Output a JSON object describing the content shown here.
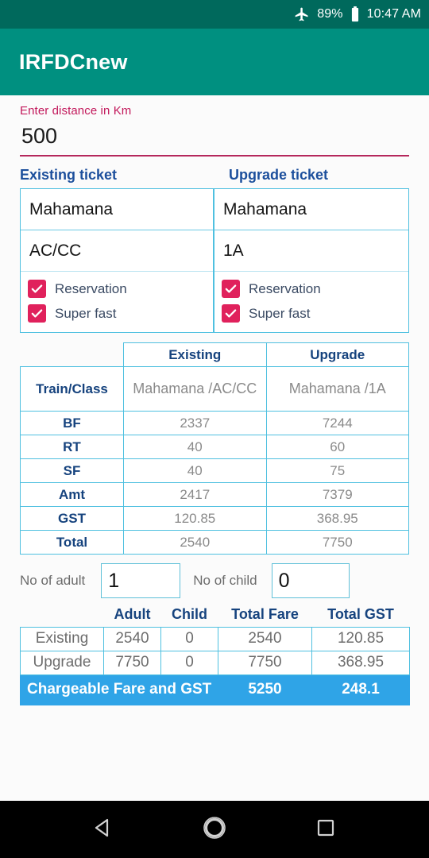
{
  "status_bar": {
    "airplane_icon": "airplane-mode-icon",
    "battery_text": "89%",
    "battery_icon": "battery-icon",
    "time": "10:47 AM"
  },
  "app_bar": {
    "title": "IRFDCnew"
  },
  "distance": {
    "label": "Enter distance in Km",
    "value": "500",
    "placeholder": "Enter distance in Km"
  },
  "tickets": {
    "existing_heading": "Existing ticket",
    "upgrade_heading": "Upgrade ticket",
    "existing": {
      "train": "Mahamana",
      "class": "AC/CC",
      "reservation_label": "Reservation",
      "superfast_label": "Super fast",
      "reservation_checked": true,
      "superfast_checked": true
    },
    "upgrade": {
      "train": "Mahamana",
      "class": "1A",
      "reservation_label": "Reservation",
      "superfast_label": "Super fast",
      "reservation_checked": true,
      "superfast_checked": true
    }
  },
  "fare_table": {
    "col_existing": "Existing",
    "col_upgrade": "Upgrade",
    "rows": [
      {
        "label": "Train/Class",
        "existing": "Mahamana /AC/CC",
        "upgrade": "Mahamana /1A"
      },
      {
        "label": "BF",
        "existing": "2337",
        "upgrade": "7244"
      },
      {
        "label": "RT",
        "existing": "40",
        "upgrade": "60"
      },
      {
        "label": "SF",
        "existing": "40",
        "upgrade": "75"
      },
      {
        "label": "Amt",
        "existing": "2417",
        "upgrade": "7379"
      },
      {
        "label": "GST",
        "existing": "120.85",
        "upgrade": "368.95"
      },
      {
        "label": "Total",
        "existing": "2540",
        "upgrade": "7750"
      }
    ]
  },
  "pax": {
    "adult_label": "No of adult",
    "adult_value": "1",
    "child_label": "No of child",
    "child_value": "0"
  },
  "summary": {
    "headers": [
      "Adult",
      "Child",
      "Total Fare",
      "Total GST"
    ],
    "rows": [
      {
        "name": "Existing",
        "adult": "2540",
        "child": "0",
        "total_fare": "2540",
        "total_gst": "120.85"
      },
      {
        "name": "Upgrade",
        "adult": "7750",
        "child": "0",
        "total_fare": "7750",
        "total_gst": "368.95"
      }
    ],
    "chargeable_label": "Chargeable Fare and GST",
    "chargeable_fare": "5250",
    "chargeable_gst": "248.1"
  },
  "nav_bar": {
    "back": "back-icon",
    "home": "home-icon",
    "recents": "recents-icon"
  },
  "colors": {
    "status_bar": "#00695c",
    "app_bar": "#009080",
    "accent_pink": "#c2185b",
    "checkbox": "#e0215c",
    "table_border": "#4fc0e0",
    "heading_blue": "#16437e",
    "highlight_blue": "#2fa4e7"
  }
}
